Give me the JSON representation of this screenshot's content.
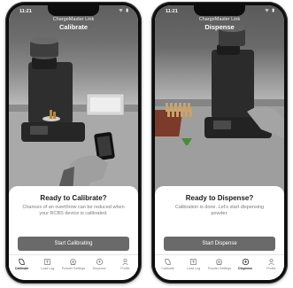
{
  "screens": [
    {
      "status_time": "11:21",
      "status_icons": "ᯤ ▮",
      "app_name": "ChargeMaster Link",
      "title": "Calibrate",
      "heading": "Ready to Calibrate?",
      "body": "Chances of an overthrow can be reduced when your RCBS device is calibrated.",
      "cta_label": "Start Calibrating",
      "tabs": [
        {
          "label": "Calibrate",
          "icon": "calibrate-icon"
        },
        {
          "label": "Load Log",
          "icon": "load-log-icon"
        },
        {
          "label": "Powder Settings",
          "icon": "powder-settings-icon"
        },
        {
          "label": "Dispense",
          "icon": "dispense-icon"
        },
        {
          "label": "Profile",
          "icon": "profile-icon"
        }
      ],
      "active_tab": "Calibrate"
    },
    {
      "status_time": "11:21",
      "status_icons": "ᯤ ▮",
      "app_name": "ChargeMaster Link",
      "title": "Dispense",
      "heading": "Ready to Dispense?",
      "body": "Calibration is done. Let's start dispensing powder.",
      "cta_label": "Start Dispense",
      "tabs": [
        {
          "label": "Calibrate",
          "icon": "calibrate-icon"
        },
        {
          "label": "Load Log",
          "icon": "load-log-icon"
        },
        {
          "label": "Powder Settings",
          "icon": "powder-settings-icon"
        },
        {
          "label": "Dispense",
          "icon": "dispense-icon"
        },
        {
          "label": "Profile",
          "icon": "profile-icon"
        }
      ],
      "active_tab": "Dispense"
    }
  ],
  "colors": {
    "cta_background": "#6a6a6a",
    "heading_text": "#1b1b1b",
    "body_text": "#7a7a7a",
    "phone_frame": "#0d0d0d"
  }
}
